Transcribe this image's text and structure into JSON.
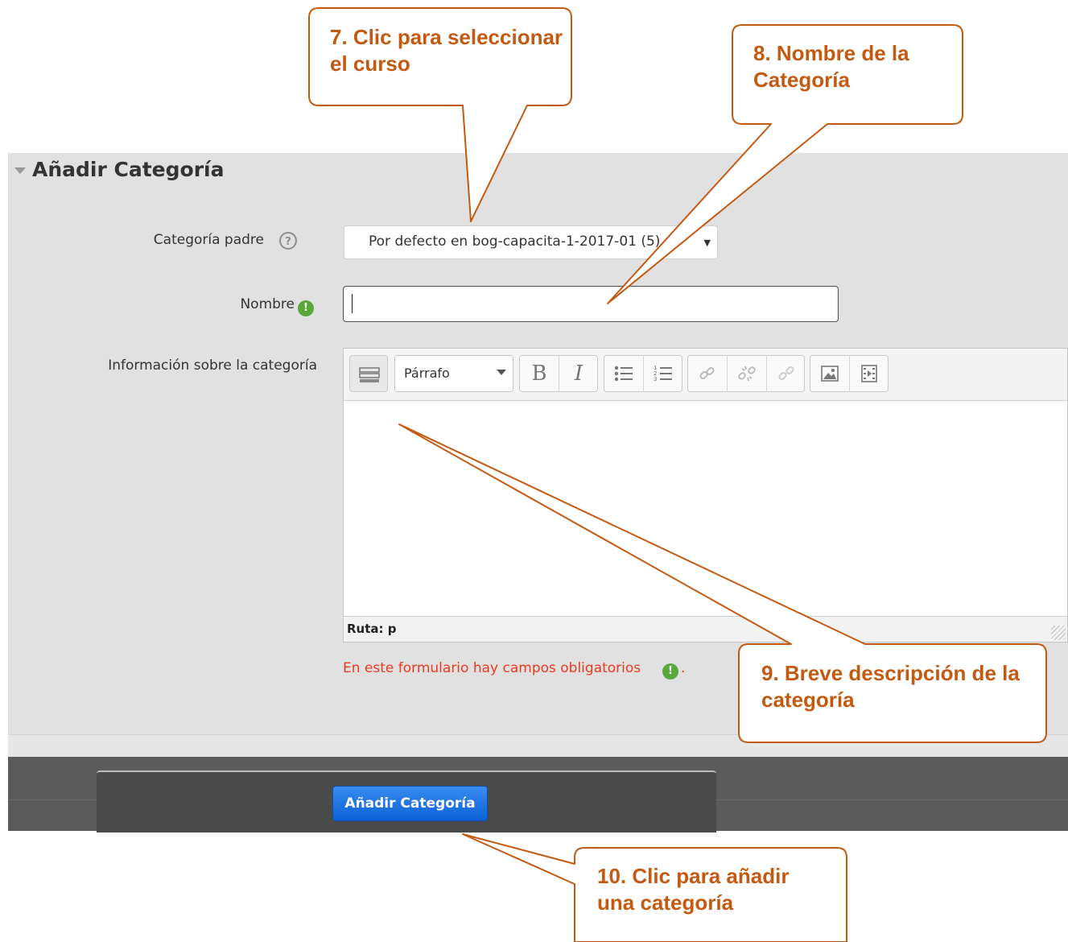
{
  "section": {
    "title": "Añadir Categoría"
  },
  "form": {
    "parent_label": "Categoría padre",
    "parent_value": "Por defecto en bog-capacita-1-2017-01 (5)",
    "help_icon": "?",
    "name_label": "Nombre",
    "name_value": "",
    "required_icon": "!",
    "info_label": "Información sobre la categoría",
    "editor": {
      "paragraph_format": "Párrafo",
      "bold": "B",
      "italic": "I",
      "icons": [
        "toolbar-toggle-icon",
        "bullet-list-icon",
        "numbered-list-icon",
        "link-icon",
        "unlink-icon",
        "anchor-icon",
        "image-icon",
        "media-icon"
      ],
      "path": "Ruta: p"
    },
    "required_note": "En este formulario hay campos obligatorios",
    "required_note_end": ".",
    "submit_label": "Añadir Categoría"
  },
  "callouts": [
    {
      "text": "7. Clic para seleccionar el curso"
    },
    {
      "text": "8. Nombre de la Categoría"
    },
    {
      "text": "9. Breve descripción de la categoría"
    },
    {
      "text": "10. Clic para añadir una categoría"
    }
  ],
  "colors": {
    "callout": "#c45a11",
    "required": "#e83b20",
    "button": "#0b62d6",
    "required_icon": "#5aa83c"
  }
}
